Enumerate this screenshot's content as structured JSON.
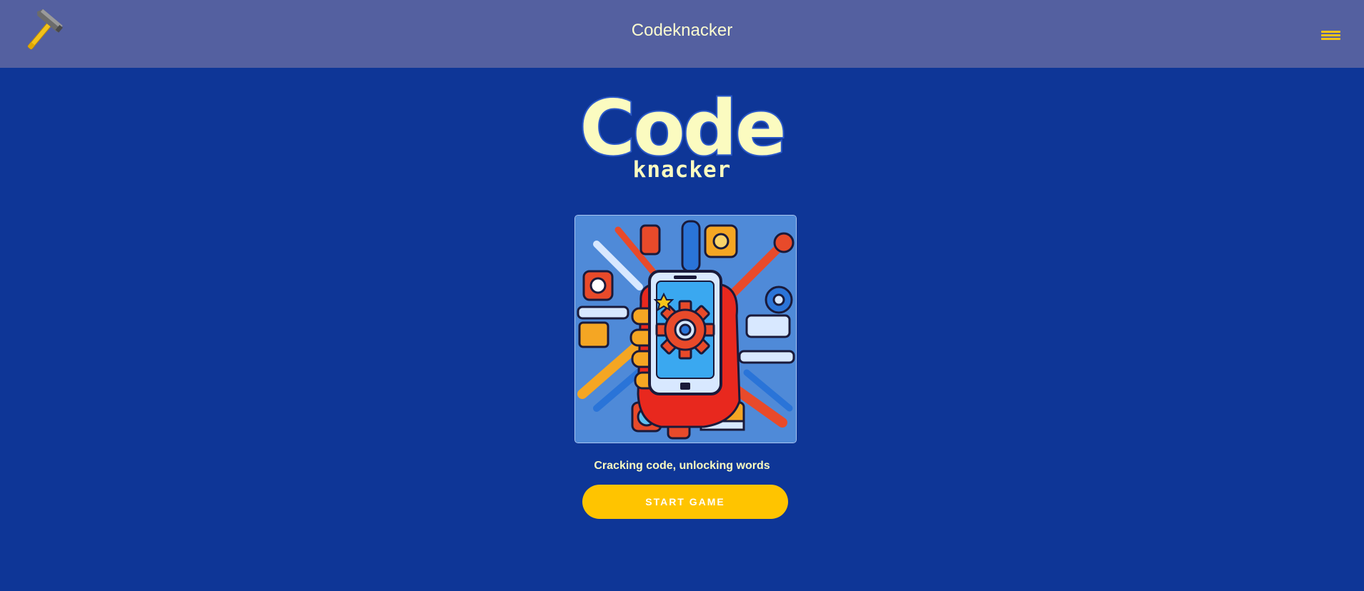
{
  "header": {
    "title": "Codeknacker",
    "logo_icon": "hammer-icon",
    "menu_icon": "hamburger-menu-icon"
  },
  "logo": {
    "big": "Code",
    "small": "knacker"
  },
  "hero": {
    "image": "gear-smartphone-tools-illustration"
  },
  "tagline": "Cracking code, unlocking words",
  "start_button": "START GAME",
  "colors": {
    "background": "#0e3697",
    "header": "#5460a0",
    "text_light": "#fbfbc0",
    "accent": "#ffc400"
  }
}
